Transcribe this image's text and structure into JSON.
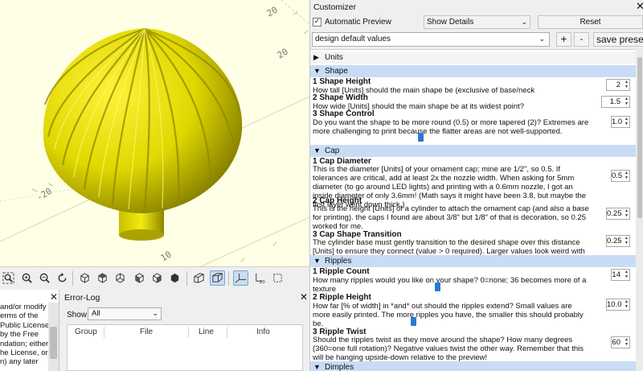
{
  "viewport": {
    "axis_labels": [
      "20",
      "20",
      "-20",
      "10"
    ]
  },
  "console": {
    "text": [
      "and/or modify",
      "erms of the",
      "Public License",
      "by the Free",
      "ndation; either",
      "he License, or",
      "n) any later"
    ]
  },
  "error_log": {
    "title": "Error-Log",
    "show_label": "Show",
    "show_value": "All",
    "columns": [
      "Group",
      "File",
      "Line",
      "Info"
    ]
  },
  "customizer": {
    "title": "Customizer",
    "auto_preview_label": "Automatic Preview",
    "details_value": "Show Details",
    "reset_label": "Reset",
    "preset_value": "design default values",
    "plus_label": "+",
    "minus_label": "-",
    "save_preset_label": "save preset",
    "groups": {
      "units": {
        "label": "Units",
        "state": "collapsed"
      },
      "shape": {
        "label": "Shape",
        "params": [
          {
            "title": "1 Shape Height",
            "desc": "How tall [Units] should the main shape be (exclusive of base/neck",
            "value": "2"
          },
          {
            "title": "2 Shape Width",
            "desc": "How wide [Units] should the main shape be at its widest point?",
            "value": "1.5"
          },
          {
            "title": "3 Shape Control",
            "desc": "Do you want the shape to be more round (0.5) or more tapered (2)? Extremes are more challenging to print because the flatter areas are not well-supported.",
            "value": "1.0"
          }
        ]
      },
      "cap": {
        "label": "Cap",
        "params": [
          {
            "title": "1 Cap Diameter",
            "desc": "This is the diameter [Units] of your ornament cap; mine are 1/2\", so 0.5. If tolerances are critical, add at least 2x the nozzle width. When asking for 5mm diameter (to go around LED lights) and printing with a 0.6mm nozzle, I got an inside diameter of only 3.6mm! (Math says it might have been 3.8, but maybe the first layer went down thick.)",
            "value": "0.5"
          },
          {
            "title": "2 Cap Height",
            "desc": "This is the height [Units] of a cylinder to attach the ornament cap (and also a base for printing). the caps I found are about 3/8\" but 1/8\" of that is decoration, so 0.25 worked for me.",
            "value": "0.25"
          },
          {
            "title": "3 Cap Shape Transition",
            "desc": "The cylinder base must gently transition to the desired shape over this distance [Units] to ensure they connect (value > 0 required). Larger values look weird with ripples.",
            "value": "0.25"
          }
        ]
      },
      "ripples": {
        "label": "Ripples",
        "params": [
          {
            "title": "1 Ripple Count",
            "desc": "How many ripples would you like on your shape? 0=none; 36 becomes more of a texture",
            "value": "14"
          },
          {
            "title": "2 Ripple Height",
            "desc": "How far [% of width] in *and* out should the ripples extend? Small values are more easily printed. The more ripples you have, the smaller this should probably be.",
            "value": "10.0"
          },
          {
            "title": "3 Ripple Twist",
            "desc": "Should the ripples twist as they move around the shape? How many degrees (360=one full rotation)? Negative values twist the other way. Remember that this will be hanging upside-down relative to the preview!",
            "value": "60"
          }
        ]
      },
      "dimples": {
        "label": "Dimples"
      }
    }
  },
  "colors": {
    "model": "#e6e000",
    "model_shadow": "#8a8400",
    "viewport_bg": "#ffffe5",
    "group_header": "#c8dcf5",
    "slider": "#2b7ad2"
  }
}
